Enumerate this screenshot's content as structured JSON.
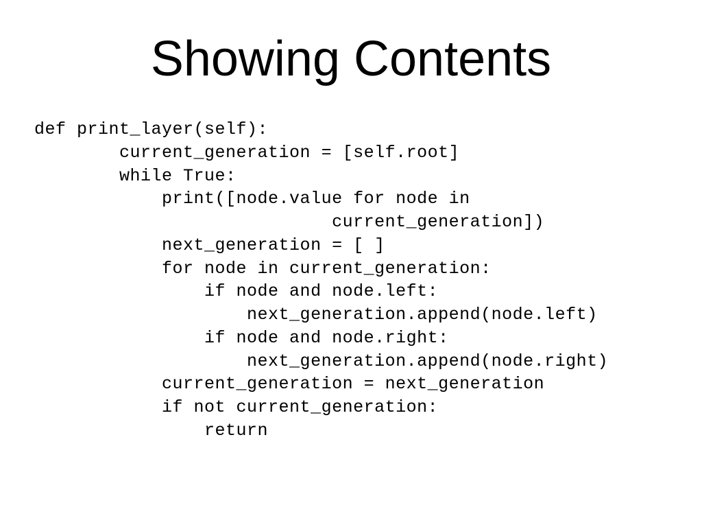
{
  "slide": {
    "title": "Showing Contents",
    "code": "def print_layer(self):\n        current_generation = [self.root]\n        while True:\n            print([node.value for node in\n                            current_generation])\n            next_generation = [ ]\n            for node in current_generation:\n                if node and node.left:\n                    next_generation.append(node.left)\n                if node and node.right:\n                    next_generation.append(node.right)\n            current_generation = next_generation\n            if not current_generation:\n                return"
  }
}
